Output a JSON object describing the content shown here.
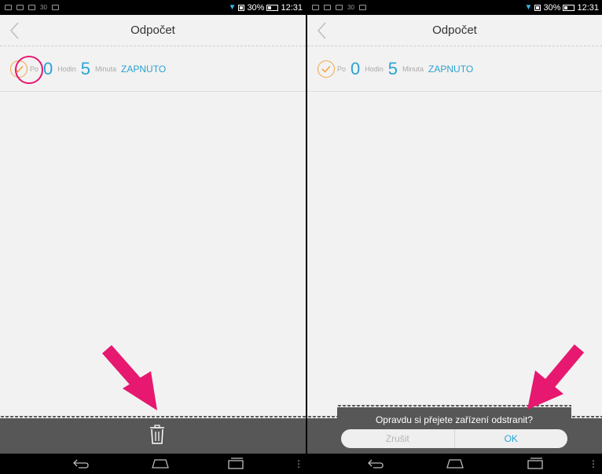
{
  "screens": [
    {
      "status": {
        "battery": "30%",
        "time": "12:31",
        "notif_count": "30"
      },
      "title": "Odpočet",
      "row": {
        "prefix": "Po",
        "hours": "0",
        "hours_label": "Hodin",
        "minutes": "5",
        "minutes_label": "Minuta",
        "state": "ZAPNUTO"
      },
      "bottom_action_icon": "trash-icon"
    },
    {
      "status": {
        "battery": "30%",
        "time": "12:31",
        "notif_count": "30"
      },
      "title": "Odpočet",
      "row": {
        "prefix": "Po",
        "hours": "0",
        "hours_label": "Hodin",
        "minutes": "5",
        "minutes_label": "Minuta",
        "state": "ZAPNUTO"
      },
      "dialog": {
        "message": "Opravdu si přejete zařízení odstranit?",
        "cancel": "Zrušit",
        "ok": "OK"
      }
    }
  ],
  "colors": {
    "accent": "#29a3d4",
    "check": "#f1a545",
    "annotation": "#e6186f",
    "bar": "#575757"
  }
}
